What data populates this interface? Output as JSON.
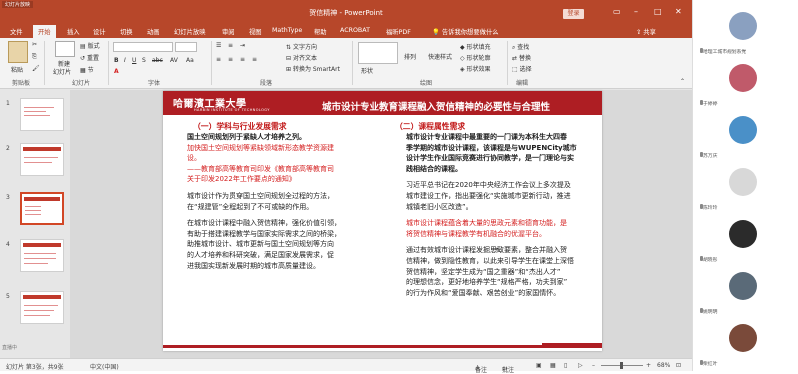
{
  "titlebar": {
    "qat_label": "幻灯片放映",
    "title": "贺信精神 - PowerPoint",
    "login": "登录"
  },
  "tabs": [
    "文件",
    "开始",
    "插入",
    "设计",
    "切换",
    "动画",
    "幻灯片放映",
    "审阅",
    "视图",
    "MathType",
    "帮助",
    "ACROBAT",
    "福昕PDF",
    "告诉我你想要做什么"
  ],
  "share": "共享",
  "ribbon": {
    "paste": "粘贴",
    "clipboard_label": "剪贴板",
    "new_slide": "新建",
    "new_slide2": "幻灯片",
    "layout": "版式",
    "reset": "重置",
    "section": "节",
    "slides_label": "幻灯片",
    "font_label": "字体",
    "paragraph_label": "段落",
    "text_direction": "文字方向",
    "align_text": "对齐文本",
    "smartart": "转换为 SmartArt",
    "shape": "形状",
    "arrange": "排列",
    "quick_styles": "快速样式",
    "shape_fill": "形状填充",
    "shape_outline": "形状轮廓",
    "shape_effects": "形状效果",
    "drawing_label": "绘图",
    "find": "查找",
    "replace": "替换",
    "select": "选择",
    "editing_label": "编辑"
  },
  "thumbnails": {
    "numbers": [
      "1",
      "2",
      "3",
      "4",
      "5"
    ],
    "selected": "3",
    "live": "直播中"
  },
  "slide": {
    "logo_cn": "哈爾濱工業大學",
    "logo_en": "HARBIN INSTITUTE OF TECHNOLOGY",
    "title": "城市设计专业教育课程融入贺信精神的必要性与合理性",
    "left": {
      "heading": "（一）学科与行业发展需求",
      "lines": [
        {
          "t": "国土空间规划列于紧缺人才培养之列。",
          "s": "b"
        },
        {
          "t": "加快国土空间规划等紧缺领域新形态教学资源建",
          "s": "r"
        },
        {
          "t": "设。",
          "s": "r"
        },
        {
          "t": "——教育部高等教育司印发《教育部高等教育司",
          "s": "r"
        },
        {
          "t": "关于印发2022年工作要点的通知》",
          "s": "r"
        },
        {
          "t": "城市设计作为贯穿国土空间规划全过程的方法，",
          "s": ""
        },
        {
          "t": "在“规建管”全程起到了不可或缺的作用。",
          "s": ""
        },
        {
          "t": "在城市设计课程中融入贺信精神，强化价值引领，",
          "s": ""
        },
        {
          "t": "有助于搭建课程教学与国家实际需求之间的桥梁，",
          "s": ""
        },
        {
          "t": "助推城市设计、城市更新与国土空间规划等方向",
          "s": ""
        },
        {
          "t": "的人才培养和科研突破，满足国家发展需求，促",
          "s": ""
        },
        {
          "t": "进我国实现新发展时期的城市高质量建设。",
          "s": ""
        }
      ]
    },
    "right": {
      "heading": "（二）课程属性需求",
      "lines": [
        {
          "t": "城市设计专业课程中最重要的一门课为本科生大四春",
          "s": "b"
        },
        {
          "t": "季学期的城市设计课程，该课程是与WUPENCity城市",
          "s": "b"
        },
        {
          "t": "设计学生作业国际竞赛进行协同教学，是一门理论与实",
          "s": "b"
        },
        {
          "t": "践相结合的课程。",
          "s": "b"
        },
        {
          "t": "习近平总书记在2020年中央经济工作会议上多次提及",
          "s": ""
        },
        {
          "t": "城市建设工作，指出要强化“实施城市更新行动，推进",
          "s": ""
        },
        {
          "t": "城镇老旧小区改造”。",
          "s": ""
        },
        {
          "t": "城市设计课程蕴含着大量的思政元素和德育功能，是",
          "s": "r"
        },
        {
          "t": "将贺信精神与课程教学有机融合的优渥平台。",
          "s": "r"
        },
        {
          "t": "通过有效城市设计课程发掘思政要素，整合并融入贺",
          "s": ""
        },
        {
          "t": "信精神，做到隐性教育，以此来引导学生在课堂上深悟",
          "s": ""
        },
        {
          "t": "贺信精神，坚定学生成为“国之重器”和“杰出人才”",
          "s": ""
        },
        {
          "t": "的理想信念，更好地培养学生“规格严格，功夫到家”",
          "s": ""
        },
        {
          "t": "的行为作风和“爱国奉献、艰苦创业”的家国情怀。",
          "s": ""
        }
      ]
    }
  },
  "status": {
    "slide_info": "幻灯片 第3张，共9张",
    "lang": "中文(中国)",
    "notes": "备注",
    "comments": "批注",
    "zoom": "68%"
  },
  "participants": [
    {
      "name": "哈理工城市规划系党",
      "color": "#8aa0c0"
    },
    {
      "name": "于婷婷",
      "color": "#c05a6a"
    },
    {
      "name": "苏万庆",
      "color": "#4a90c8"
    },
    {
      "name": "陈玲玲",
      "color": "#d8d8d8"
    },
    {
      "name": "胡晓彤",
      "color": "#2b2b2b"
    },
    {
      "name": "姚明明",
      "color": "#5a6a78"
    },
    {
      "name": "柴红叶",
      "color": "#7a4a3a"
    }
  ]
}
